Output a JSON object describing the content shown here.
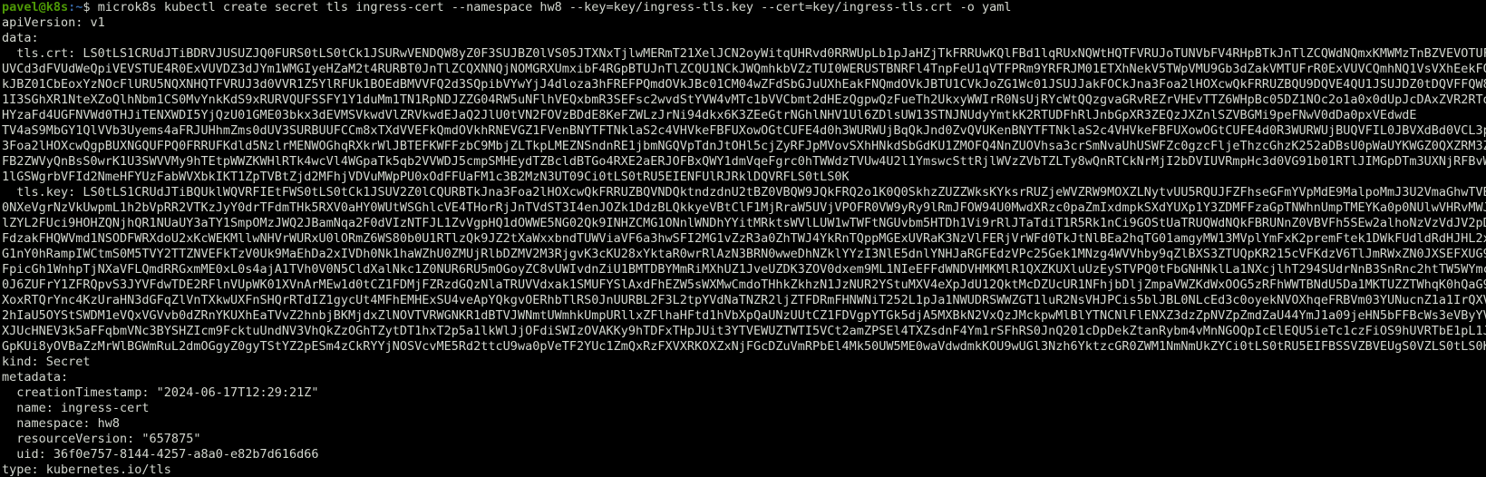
{
  "prompt": {
    "user_host": "pavel@k8s",
    "path": ":~",
    "symbol": "$ ",
    "command": "microk8s kubectl create secret tls ingress-cert --namespace hw8 --key=key/ingress-tls.key --cert=key/ingress-tls.crt -o yaml"
  },
  "output_lines": [
    "apiVersion: v1",
    "data:",
    "  tls.crt: LS0tLS1CRUdJTiBDRVJUSUZJQ0FURS0tLS0tCk1JSURwVENDQW8yZ0F3SUJBZ0lVS05JTXNxTjlwMERmT21XelJCN2oyWitqUHRvd0RRWUpLb1pJaHZjTkFRRUwKQlFBd1lqRUxNQWtHQTFVRUJoTUNVbFV4RHpBTkJnTlZCQWdNQmxKMWMzTnBZVEVOTUFzR0",
    "UVCd3dFVUdWeQpiVEVSTUE4R0ExVUVDZ3dJYm1WMGIyeHZaM2t4RURBT0JnTlZCQXNNQjNOMGRXUmxibF4RGpBTUJnTlZCQU1NCkJWQmhkbVZzTUI0WERUSTBNRFl4TnpFeU1qVTFPRm9YRFRJM01ETXhNekV5TWpVMU9Gb3dZakVMTUFrR0ExVUVCQmhNQ1VsVXhEekFOQm",
    "kJBZ01CbEoxYzNOcFlURU5NQXNHQTFVRUJ3d0VVR1Z5YlRFUk1BOEdBMVVFQ2d3SQpibVYwYjJ4dloza3hFREFPQmdOVkJBc01CM04wZFdSbGJuUXhEakFNQmdOVkJBTU1CVkJoZG1Wc01JSUJJakFOCkJna3Foa2lHOXcwQkFRRUZBQU9DQVE4QU1JSUJDZ0tDQVFFQW8rZm",
    "1I3SGhXR1NteXZoQlhNbm1CS0MvYnkKdS9xRURVQUFSSFY1Y1duMm1TN1RpNDJZZG04RW5uNFlhVEQxbmR3SEFsc2wvdStYVW4vMTc1bVVCbmt2dHEzQgpwQzFueTh2UkxyWWIrR0NsUjRYcWtQQzgvaGRvREZrVHEvTTZ6WHpBc05DZ1NOc2o1a0x0dUpJcDAxZVR2RTdWCk",
    "HYzaFd4UGFNVWd0THJiTENXWDI5YjQzU01GME03bkx3dEVMSVkwdVlZRVkwdEJaQ2JlU0tVN2FOVzBDdE8KeFZWLzJrNi94dkx6K3ZEeGtrNGhlNHV1Ul6ZDlsUW13STNJNUdyYmtkK2RTUDFhRlJnbGpXR3ZEQzJXZnlSZVBGMi9peFNwV0dDa0pxVEdwdE",
    "TV4aS9MbGY1QlVVb3Uyems4aFRJUHhmZms0dUV3SURBUUFCCm8xTXdVVEFkQmdOVkhRNEVGZ1FVenBNYTFTNklaS2c4VHVkeFBFUXowOGtCUFE4d0h3WURWUjBqQkJnd0ZvQVUKenBNYTFTNklaS2c4VHVkeFBFUXowOGtCUFE4d0R3WURWUjBUQVFIL0JBVXdBd0VCL3pBTk",
    "3Foa2lHOXcwQgpBUXNGQUFPQ0FRRUFKdld5NzlrMENWOGhqRXkrWlJBTEFKWFFzbC9MbjZLTkpLMEZNSndnRE1jbmNGQVpTdnJtOHl5cjZyRFJpMVovSXhHNkdSbGdKU1ZMOFQ4NnZUOVhsa3crSmNvaUhUSWFZc0gzcFljeThzcGhzK252aDBsU0pWaUYKWGZ0QXZRM3Z5cUxwL2",
    "FB2ZWVyQnBsS0wrK1U3SWVVMy9hTEtpWWZKWHlRTk4wcVl4WGpaTk5qb2VVWDJ5cmpSMHEydTZBcldBTGo4RXE2aERJOFBxQWY1dmVqeFgrc0hTWWdzTVUw4U2l1YmswcSttRjlWVzZVbTZLTy8wQnRTCkNrMjI2bDVIUVRmpHc3d0VG91b01RTlJIMGpDTm3UXNjRFBvWW9yMk",
    "1lGSWgrbVFId2NmeHFYUzFabWVXbkIKT1ZpTVBtZjd2MFhjVDVuMWpPU0xOdFFUaFM1c3B2MzN3UT09Ci0tLS0tRU5EIENFUlRJRklDQVRFLS0tLS0K",
    "  tls.key: LS0tLS1CRUdJTiBQUklWQVRFIEtFWS0tLS0tCk1JSUV2Z0lCQURBTkJna3Foa2lHOXcwQkFRRUZBQVNDQktndzdnU2tBZ0VBQW9JQkFRQ2o1K0Q0SkhzZUZZWksKYksrRUZjeWVZRW9MOXZLNytvUU5RQUJFZFhseGFmYVpMdE9MalpoMmJ3U2VmaGhwTVBXZD",
    "0NXeVgrNzVkUwpmL1h2bVpRR2VTKzJyY0drTFdmTHk5RXV0aHY0WUtWSGhlcVE4THorRjJnTVdST3I4enJOZk1DdzBLQkkyeVBtClF1MjRraW5UVjVPOFR0VW9yRy9lRmJFOW94U0MwdXRzc0paZmIxdmpkSXdYUXp1Y3ZDMFFzaGpTNWhnUmpTMEYKa0p0NUlwVHRvMWJRS0",
    "lZYL2FUci9HOHZQNjhQR1NUaUY3aTY1SmpOMzJWQ2JBamNqa2F0dVIzNTFJL1ZvVgpHQ1dOWWE5NG02Qk9INHZCMG1ONnlWNDhYYitMRktsWVlLUW1wTWFtNGUvbm5HTDh1Vi9rRlJTaTdiT1R5Rk1nCi9GOStUaTRUQWdNQkFBRUNnZ0VBVFh5SEw2alhoNzVzVdJV2pDU",
    "FdzakFHQWVmd1NSODFWRXdoU2xKcWEKMllwNHVrWURxU0lORmZ6WS80b0U1RTlzQk9JZ2tXaWxxbndTUWViaVF6a3hwSFI2MG1vZzR3a0ZhTWJ4YkRnTQppMGExUVRaK3NzVlFERjVrWFd0TkJtNlBEa2hqTG01amgyMW13MVplYmFxK2premFtek1DWkFUdldRdHJHL2xtCk",
    "G1nY0hRampIWCtmS0M5TVY2TTZNVEFkTzV0Uk9MaEhDa2xIVDh0Nk1haWZhU0ZMUjRlbDZMV2M3RjgvK3cKU28xYktaR0wrRlAzN3BRN0wweDhNZklYYzI3NlE5dnlYNHJaRGFEdzVPc25Gek1MNzg4WVVhby9qZlBXS3ZTUQpKR215cVFKdzV6TlJmRWxZN0JXSEFXUG9mZE",
    "FpicGh1WnhpTjNXaVFLQmdRRGxmME0xL0s4ajA1TVh0V0N5CldXalNkc1Z0NUR6RU5mOGoyZC8vUWIvdnZiU1BMTDBYMmRiMXhUZ1JveUZDK3ZOV0dxem9ML1NIeEFFdWNDVHMKMlR1QXZKUXluUzEySTVPQ0tFbGNHNklLa1NXcjlhT294SUdrNnB3SnRnc2htTW5WYmczQ1",
    "0J6ZUFrY1ZFRQpvS3JYVFdwTDE2RFlnVUpWK01XVnArMEw1d0tCZ1FDMjFZRzdGQzNlaTRUVVdxak1SMUFYSlAxdFhEZW5sWXMwCmdoTHhkZkhzN1JzNUR2YStuMXV4eXpJdU12QktMcDZUcUR1NFhjbDljZmpaVWZKdWxOOG5zRFhWWTBNdU5Da1MKTUZZTWhqK0hQaG9aWU",
    "XoxRTQrYnc4KzUraHN3dGFqZlVnTXkwUXFnSHQrRTdIZ1gycUt4MFhEMHExSU4veApYQkgvOERhbTlRS0JnUURBL2F3L2tpYVdNaTNZR2ljZTFDRmFHNWNiT252L1pJa1NWUDRSWWZGT1luR2NsVHJPCis5blJBL0NLcEd3c0oyekNVOXhqeFRBVm03YUNucnZ1a1IrQXV4VE",
    "2hIaU5OYStSWDM1eVQxVGVvb0dZRnYKUXhEaTVvZ2hnbjBKMjdxZlNOVTVRWGNKR1dBTVJWNmtUWmhkUmpURllxZFlhaHFtd1hVbXpQaUNzUUtCZ1FDVgpYTGk5djA5MXBkN2VxQzJMckpwMlBlYTNCNlFlENXZ3dzZpNVZpZmdZaU44YmJ1a09jeHN5bFFBcWs3eVByYVFvCm",
    "XJUcHNEV3k5aFFqbmVNc3BYSHZIcm9FcktuUndNV3VhQkZzOGhTZytDT1hxT2p5a1lkWlJjOFdiSWIzOVAKKy9hTDFxTHpJUit3YTVEWUZTWTI5VCt2amZPSEl4TXZsdnF4Ym1rSFhRS0JnQ201cDpDekZtanRybm4vMnNGOQpIcElEQU5ieTc1czFiOS9hUVRTbE1pL1J2UT",
    "GpKUi8yOVBaZzMrWlBGWmRuL2dmOGgyZ0gyTStYZ2pESm4zCkRYYjNOSVcvME5Rd2ttcU9wa0pVeTF2YUc1ZmQxRzFXVXRKOXZxNjFGcDZuVmRPbEl4Mk50UW5ME0waVdwdmkKOU9wUGl3Nzh6YktzcGR0ZWM1NmNmUkZYCi0tLS0tRU5EIFBSSVZBVEUgS0VZLS0tLS0K",
    "kind: Secret",
    "metadata:",
    "  creationTimestamp: \"2024-06-17T12:29:21Z\"",
    "  name: ingress-cert",
    "  namespace: hw8",
    "  resourceVersion: \"657875\"",
    "  uid: 36f0e757-8144-4257-a8a0-e82b7d616d66",
    "type: kubernetes.io/tls"
  ],
  "colors": {
    "background": "#000000",
    "foreground": "#d3d7cf",
    "prompt_user": "#4e9a06",
    "prompt_path": "#3465a4"
  }
}
